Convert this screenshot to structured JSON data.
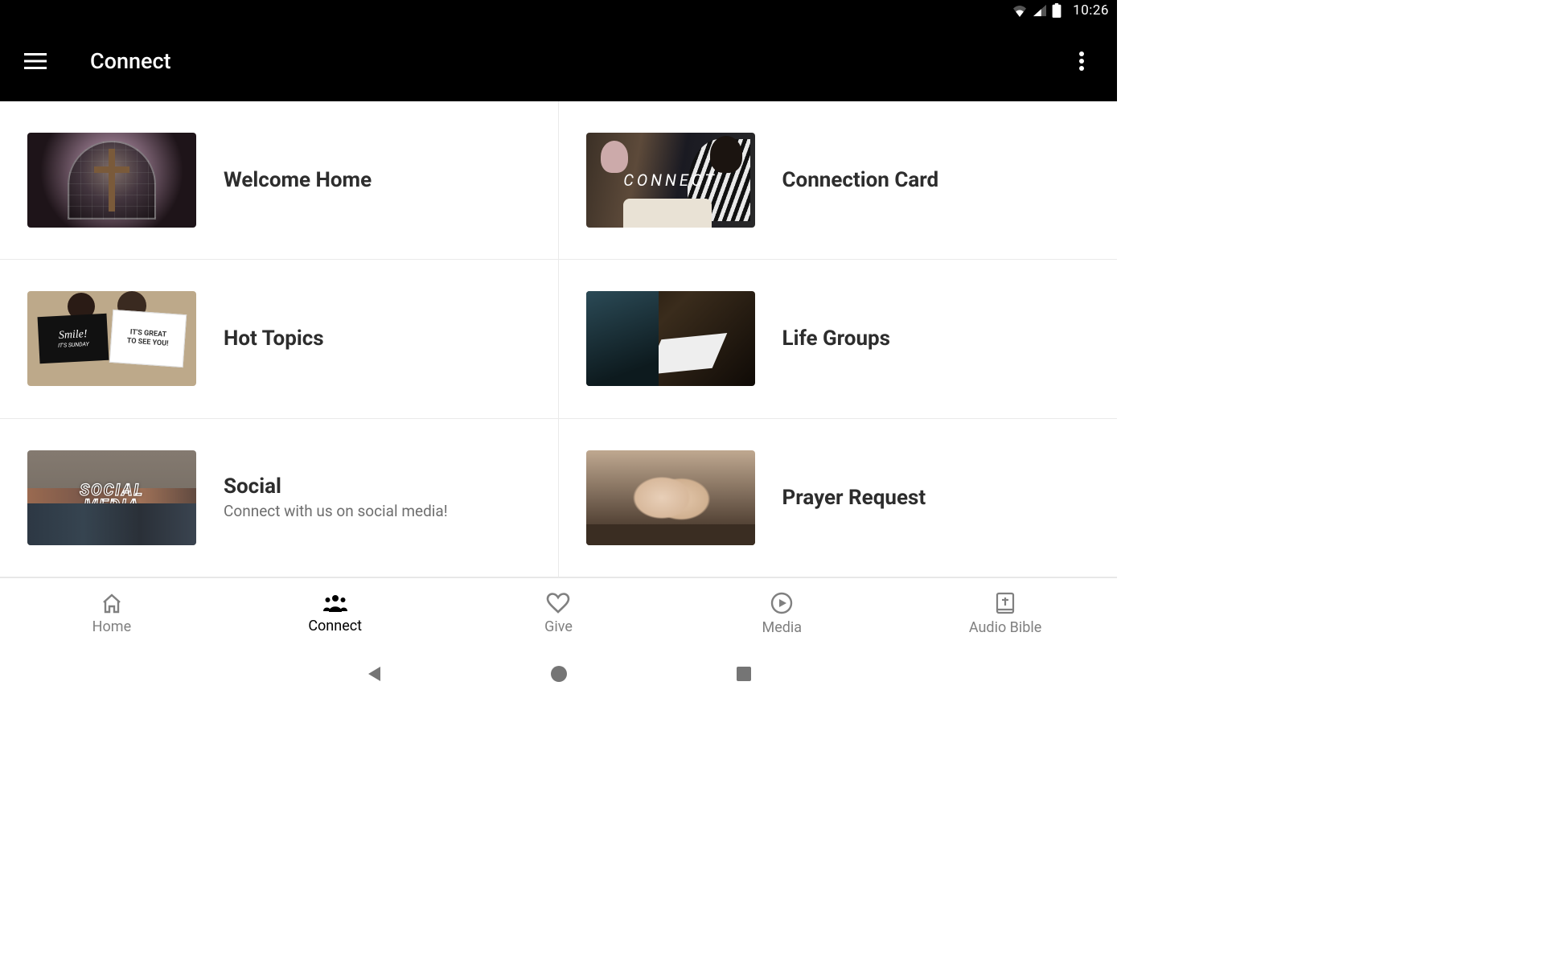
{
  "status": {
    "time": "10:26"
  },
  "appbar": {
    "title": "Connect"
  },
  "items": [
    {
      "title": "Welcome Home",
      "subtitle": ""
    },
    {
      "title": "Connection Card",
      "subtitle": "",
      "overlay": "CONNECT"
    },
    {
      "title": "Hot Topics",
      "subtitle": "",
      "sign_left_top": "Smile!",
      "sign_left_bottom": "IT'S SUNDAY",
      "sign_right_top": "IT'S GREAT",
      "sign_right_bottom": "TO SEE YOU!"
    },
    {
      "title": "Life Groups",
      "subtitle": ""
    },
    {
      "title": "Social",
      "subtitle": "Connect with us on social media!",
      "overlay_top": "SOCIAL",
      "overlay_bottom": "MEDIA"
    },
    {
      "title": "Prayer Request",
      "subtitle": ""
    }
  ],
  "nav": {
    "home": "Home",
    "connect": "Connect",
    "give": "Give",
    "media": "Media",
    "audio_bible": "Audio Bible"
  }
}
